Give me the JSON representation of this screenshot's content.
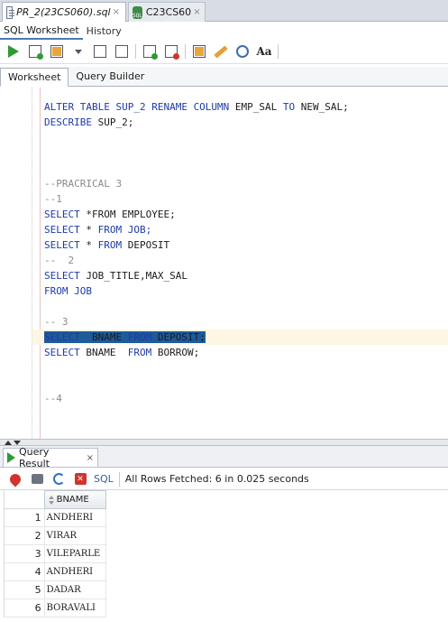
{
  "file_tabs": [
    {
      "label": "PR_2(23CS060).sql",
      "close": "×"
    },
    {
      "label": "C23CS60",
      "close": "×"
    }
  ],
  "sub_tabs": [
    "SQL Worksheet",
    "History"
  ],
  "editor_tabs": [
    "Worksheet",
    "Query Builder"
  ],
  "editor_lines": [
    [
      {
        "t": "ALTER TABLE SUP_2 RENAME COLUMN ",
        "c": "kw"
      },
      {
        "t": "EMP_SAL ",
        "c": "tx"
      },
      {
        "t": "TO ",
        "c": "kw"
      },
      {
        "t": "NEW_SAL;",
        "c": "tx"
      }
    ],
    [
      {
        "t": "DESCRIBE ",
        "c": "kw"
      },
      {
        "t": "SUP_2;",
        "c": "tx"
      }
    ],
    [],
    [],
    [],
    [
      {
        "t": "--PRACRICAL 3",
        "c": "cm"
      }
    ],
    [
      {
        "t": "--1",
        "c": "cm"
      }
    ],
    [
      {
        "t": "SELECT ",
        "c": "kw"
      },
      {
        "t": "*FROM ",
        "c": "tx"
      },
      {
        "t": "EMPLOYEE;",
        "c": "tx"
      }
    ],
    [
      {
        "t": "SELECT ",
        "c": "kw"
      },
      {
        "t": "* ",
        "c": "tx"
      },
      {
        "t": "FROM ",
        "c": "kw"
      },
      {
        "t": "JOB;",
        "c": "kw"
      }
    ],
    [
      {
        "t": "SELECT ",
        "c": "kw"
      },
      {
        "t": "* ",
        "c": "tx"
      },
      {
        "t": "FROM ",
        "c": "kw"
      },
      {
        "t": "DEPOSIT",
        "c": "tx"
      }
    ],
    [
      {
        "t": "--  2",
        "c": "cm"
      }
    ],
    [
      {
        "t": "SELECT ",
        "c": "kw"
      },
      {
        "t": "JOB_TITLE,MAX_SAL",
        "c": "tx"
      }
    ],
    [
      {
        "t": "FROM ",
        "c": "kw"
      },
      {
        "t": "JOB",
        "c": "kw"
      }
    ],
    [],
    [
      {
        "t": "-- 3",
        "c": "cm"
      }
    ],
    [
      {
        "t": "SELECT  ",
        "c": "kw",
        "sel": true
      },
      {
        "t": "BNAME ",
        "c": "tx",
        "sel": true
      },
      {
        "t": "FROM ",
        "c": "kw",
        "sel": true
      },
      {
        "t": "DEPOSIT;",
        "c": "tx",
        "sel": true
      }
    ],
    [
      {
        "t": "SELECT ",
        "c": "kw"
      },
      {
        "t": "BNAME  ",
        "c": "tx"
      },
      {
        "t": "FROM ",
        "c": "kw"
      },
      {
        "t": "BORROW;",
        "c": "tx"
      }
    ],
    [],
    [],
    [
      {
        "t": "--4",
        "c": "cm"
      }
    ]
  ],
  "results": {
    "tab_label": "Query Result",
    "tab_close": "×",
    "sql_button": "SQL",
    "status": "All Rows Fetched: 6 in 0.025 seconds",
    "column": "BNAME",
    "rows": [
      {
        "n": "1",
        "v": "ANDHERI"
      },
      {
        "n": "2",
        "v": "VIRAR"
      },
      {
        "n": "3",
        "v": "VILEPARLE"
      },
      {
        "n": "4",
        "v": "ANDHERI"
      },
      {
        "n": "5",
        "v": "DADAR"
      },
      {
        "n": "6",
        "v": "BORAVALI"
      }
    ]
  },
  "icons": [
    "run-statement-icon",
    "run-script-icon",
    "autotrace-icon",
    "explain-plan-icon",
    "sql-tuning-icon",
    "commit-icon",
    "rollback-icon",
    "unshared-sql-icon",
    "clear-icon",
    "history-icon",
    "format-icon"
  ],
  "colors": {
    "keyword": "#1e3aa8",
    "comment": "#8a8a8a",
    "selection": "#1f5a9b",
    "current_line": "#fdf6e3"
  }
}
